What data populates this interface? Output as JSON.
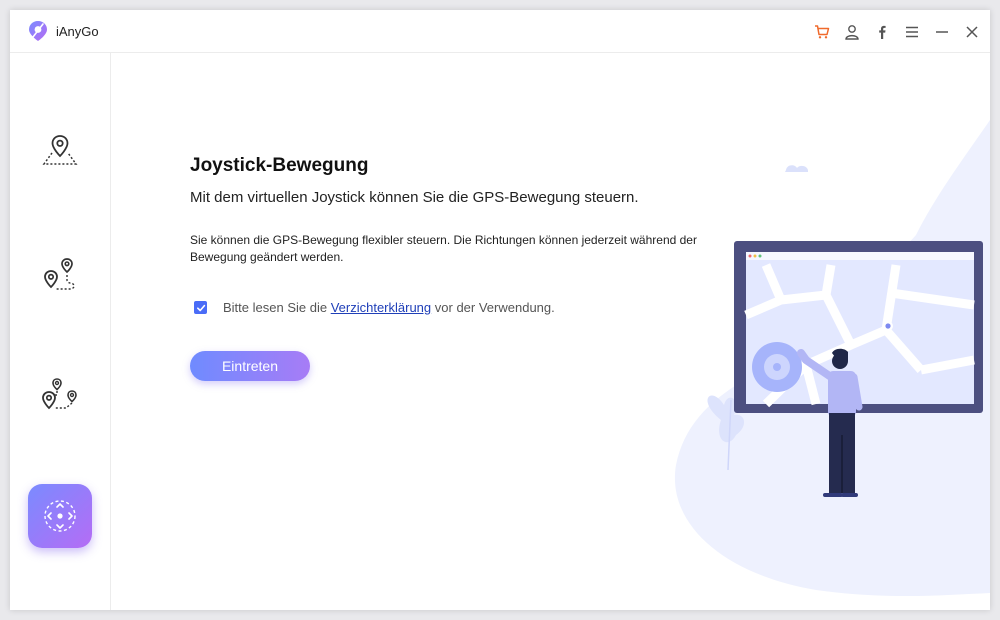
{
  "app": {
    "name": "iAnyGo"
  },
  "titlebar": {
    "icons": [
      "cart-icon",
      "user-icon",
      "facebook-icon",
      "menu-icon",
      "minimize-icon",
      "close-icon"
    ],
    "accent_color": "#f06a2c"
  },
  "sidebar": {
    "items": [
      {
        "icon": "teleport-location-icon"
      },
      {
        "icon": "two-spot-route-icon"
      },
      {
        "icon": "multi-spot-route-icon"
      },
      {
        "icon": "joystick-icon",
        "active": true
      }
    ]
  },
  "main": {
    "title": "Joystick-Bewegung",
    "subtitle": "Mit dem virtuellen Joystick können Sie die GPS-Bewegung steuern.",
    "description": "Sie können die GPS-Bewegung flexibler steuern. Die Richtungen können jederzeit während der Bewegung geändert werden.",
    "consent": {
      "checked": true,
      "prefix": "Bitte lesen Sie die",
      "link": "Verzichterklärung",
      "suffix": "vor der Verwendung."
    },
    "enter_button": "Eintreten"
  },
  "colors": {
    "primary": "#4a6cf7",
    "gradient_start": "#6f8bff",
    "gradient_end": "#a77cf6"
  }
}
